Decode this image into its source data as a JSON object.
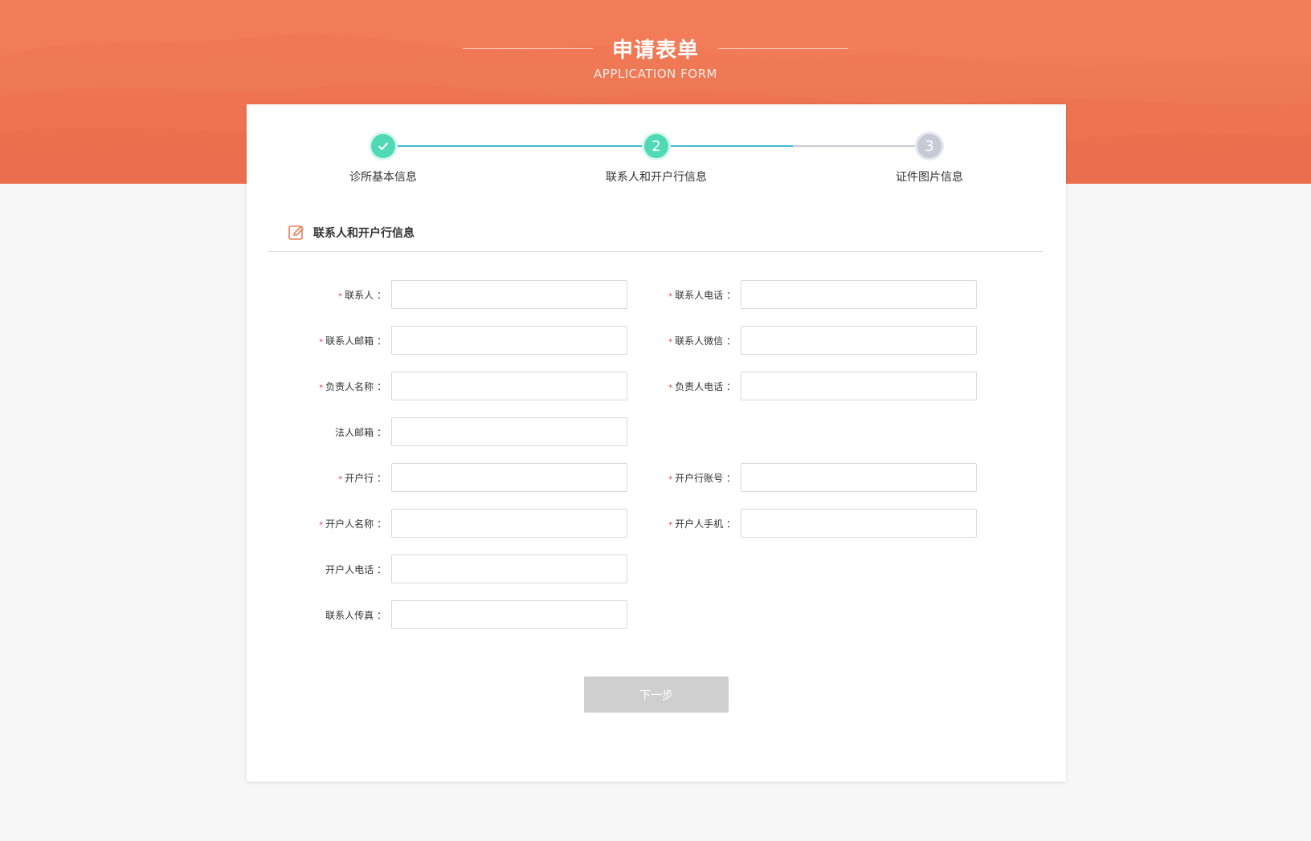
{
  "header": {
    "title_cn": "申请表单",
    "title_en": "APPLICATION FORM"
  },
  "steps": [
    {
      "number": "1",
      "label": "诊所基本信息",
      "state": "done",
      "icon": "check-icon"
    },
    {
      "number": "2",
      "label": "联系人和开户行信息",
      "state": "active"
    },
    {
      "number": "3",
      "label": "证件图片信息",
      "state": "todo"
    }
  ],
  "section": {
    "title": "联系人和开户行信息",
    "icon": "edit-icon"
  },
  "form": {
    "contact_name": {
      "label": "联系人",
      "required": true,
      "value": ""
    },
    "contact_phone": {
      "label": "联系人电话",
      "required": true,
      "value": ""
    },
    "contact_email": {
      "label": "联系人邮箱",
      "required": true,
      "value": ""
    },
    "contact_wechat": {
      "label": "联系人微信",
      "required": true,
      "value": ""
    },
    "manager_name": {
      "label": "负责人名称",
      "required": true,
      "value": ""
    },
    "manager_phone": {
      "label": "负责人电话",
      "required": true,
      "value": ""
    },
    "legal_email": {
      "label": "法人邮箱",
      "required": false,
      "value": ""
    },
    "bank": {
      "label": "开户行",
      "required": true,
      "value": ""
    },
    "bank_account": {
      "label": "开户行账号",
      "required": true,
      "value": ""
    },
    "account_holder": {
      "label": "开户人名称",
      "required": true,
      "value": ""
    },
    "holder_mobile": {
      "label": "开户人手机",
      "required": true,
      "value": ""
    },
    "holder_phone": {
      "label": "开户人电话",
      "required": false,
      "value": ""
    },
    "contact_fax": {
      "label": "联系人传真",
      "required": false,
      "value": ""
    },
    "colon": "："
  },
  "actions": {
    "next_label": "下一步"
  },
  "colors": {
    "banner": "#f07a56",
    "step_done": "#4fd9b5",
    "step_todo": "#c6cad4",
    "progress_line": "#46b9d8",
    "required_mark": "#e8413e",
    "button_disabled": "#cfcfcf"
  }
}
